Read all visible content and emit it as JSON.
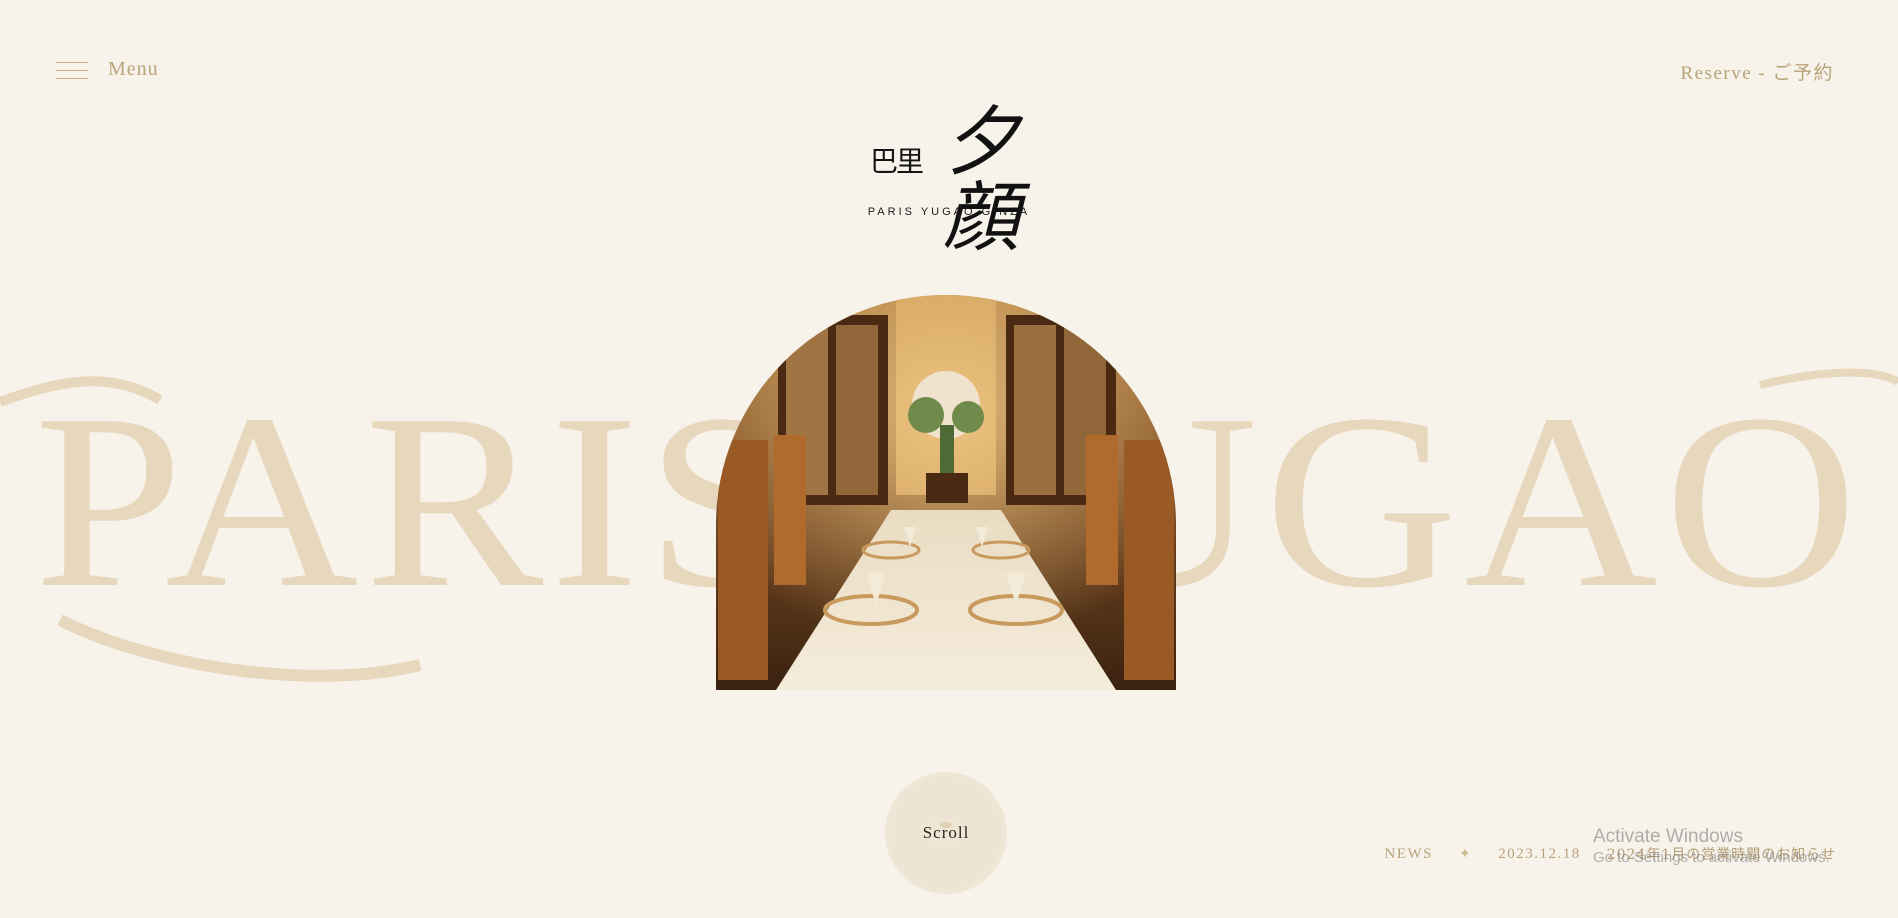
{
  "header": {
    "menu_label": "Menu",
    "reserve_label": "Reserve - ご予約"
  },
  "logo": {
    "mark_small": "巴里",
    "mark_large": "夕顔",
    "subtitle": "PARIS YUGAO GINZA"
  },
  "watermark": {
    "text": "PARIS YUGAO",
    "color": "#e6d7bd"
  },
  "hero": {
    "image_icon": "dining-room-photo"
  },
  "scroll": {
    "label": "Scroll"
  },
  "news": {
    "label": "NEWS",
    "separator": "✦",
    "date": "2023.12.18",
    "title": "2024年1月の営業時間のお知らせ"
  },
  "system_overlay": {
    "title": "Activate Windows",
    "subtitle": "Go to Settings to activate Windows."
  },
  "colors": {
    "background": "#f7f2ea",
    "accent_gold": "#b9a37a",
    "logo_black": "#111111"
  }
}
